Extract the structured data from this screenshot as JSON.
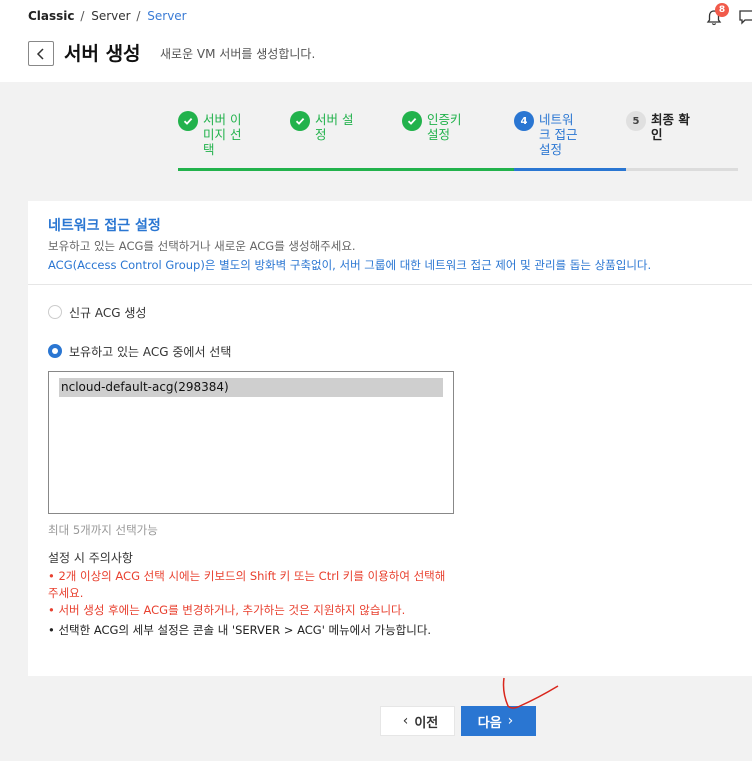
{
  "breadcrumb": {
    "root": "Classic",
    "level1": "Server",
    "current": "Server"
  },
  "notifications": {
    "count": "8"
  },
  "header": {
    "title": "서버 생성",
    "subtitle": "새로운 VM 서버를 생성합니다."
  },
  "steps": [
    {
      "number": "1",
      "label": "서버 이미지 선택",
      "status": "done"
    },
    {
      "number": "2",
      "label": "서버 설정",
      "status": "done"
    },
    {
      "number": "3",
      "label": "인증키 설정",
      "status": "done"
    },
    {
      "number": "4",
      "label": "네트워크 접근 설정",
      "status": "active"
    },
    {
      "number": "5",
      "label": "최종 확인",
      "status": "pending"
    }
  ],
  "section": {
    "title": "네트워크 접근 설정",
    "desc1": "보유하고 있는 ACG를 선택하거나 새로운 ACG를 생성해주세요.",
    "desc2": "ACG(Access Control Group)은 별도의 방화벽 구축없이, 서버 그룹에 대한 네트워크 접근 제어 및 관리를 돕는 상품입니다."
  },
  "options": {
    "new_acg": "신규 ACG 생성",
    "existing_acg": "보유하고 있는 ACG 중에서 선택",
    "selected": "existing_acg"
  },
  "acg_list": [
    "ncloud-default-acg(298384)"
  ],
  "limit_text": "최대 5개까지 선택가능",
  "notes": {
    "title": "설정 시 주의사항",
    "items": [
      "• 2개 이상의 ACG 선택 시에는 키보드의 Shift 키 또는 Ctrl 키를 이용하여 선택해주세요.",
      "• 서버 생성 후에는 ACG를 변경하거나, 추가하는 것은 지원하지 않습니다.",
      "• 선택한 ACG의 세부 설정은 콘솔 내 'SERVER > ACG' 메뉴에서 가능합니다."
    ]
  },
  "buttons": {
    "prev": "이전",
    "next": "다음"
  },
  "colors": {
    "accent": "#2a76d2",
    "done": "#22b24c",
    "warning": "#e8402f"
  }
}
